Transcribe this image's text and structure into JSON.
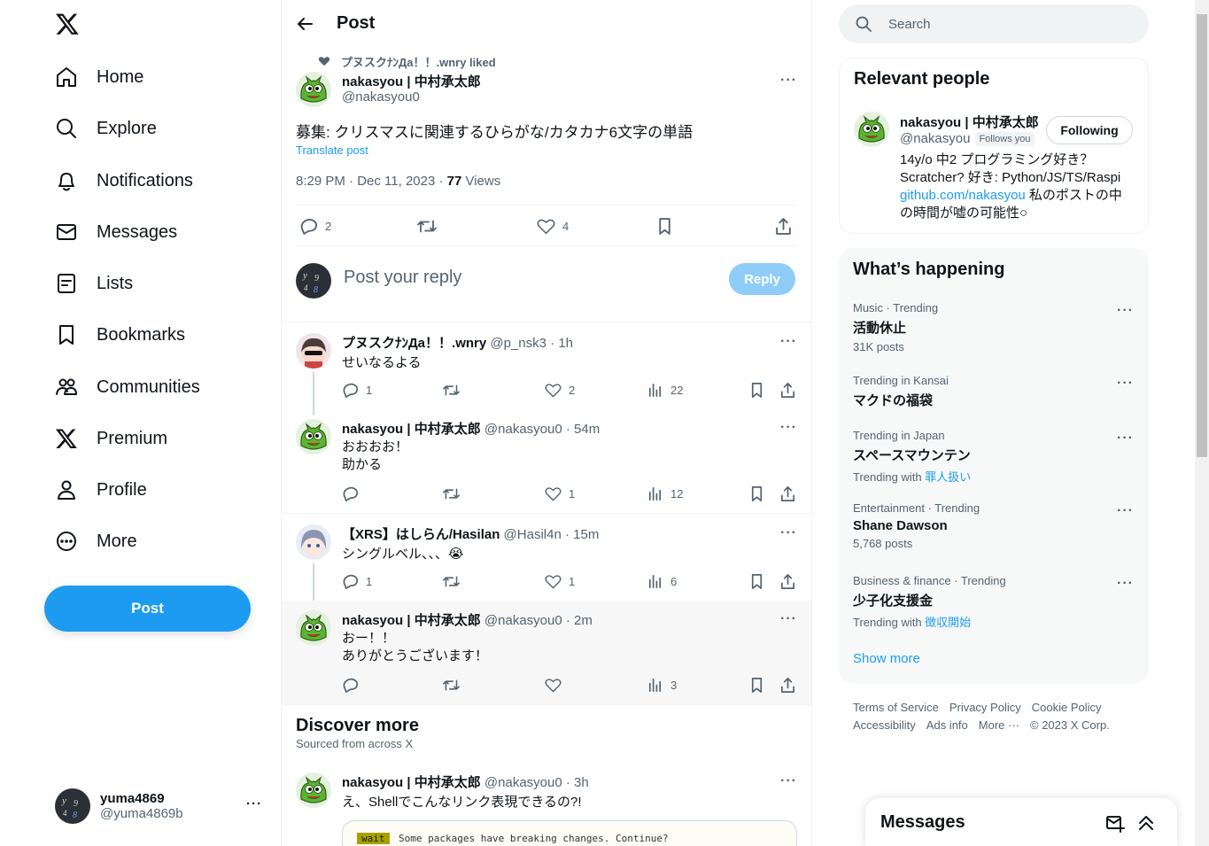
{
  "nav": {
    "items": [
      {
        "label": "Home",
        "icon": "home-icon"
      },
      {
        "label": "Explore",
        "icon": "search-icon"
      },
      {
        "label": "Notifications",
        "icon": "bell-icon"
      },
      {
        "label": "Messages",
        "icon": "envelope-icon"
      },
      {
        "label": "Lists",
        "icon": "list-icon"
      },
      {
        "label": "Bookmarks",
        "icon": "bookmark-icon"
      },
      {
        "label": "Communities",
        "icon": "communities-icon"
      },
      {
        "label": "Premium",
        "icon": "x-logo-icon"
      },
      {
        "label": "Profile",
        "icon": "person-icon"
      },
      {
        "label": "More",
        "icon": "more-circle-icon"
      }
    ],
    "post_button": "Post",
    "account": {
      "name": "yuma4869",
      "handle": "@yuma4869b"
    }
  },
  "header": {
    "title": "Post"
  },
  "main_post": {
    "social_context": "プヌスクﾅﾝДа！！.wnry liked",
    "author_name": "nakasyou | 中村承太郎",
    "author_handle": "@nakasyou0",
    "text": "募集: クリスマスに関連するひらがな/カタカナ6文字の単語",
    "translate": "Translate post",
    "timestamp": "8:29 PM · Dec 11, 2023 · ",
    "views_count": "77",
    "views_label": " Views",
    "replies": "2",
    "likes": "4"
  },
  "reply_box": {
    "placeholder": "Post your reply",
    "button": "Reply"
  },
  "replies": [
    {
      "name": "プヌスクﾅﾝДа！！.wnry",
      "meta": "@p_nsk3 · 1h",
      "lines": [
        "せいなるよる"
      ],
      "replies": "1",
      "retweets": "",
      "likes": "2",
      "views": "22"
    },
    {
      "name": "nakasyou | 中村承太郎",
      "meta": "@nakasyou0 · 54m",
      "lines": [
        "おおおお！",
        "助かる"
      ],
      "replies": "",
      "retweets": "",
      "likes": "1",
      "views": "12"
    },
    {
      "name": "【XRS】はしらん/Hasilan",
      "meta": "@Hasil4n · 15m",
      "lines": [
        "シングルベル、、、😭"
      ],
      "replies": "1",
      "retweets": "",
      "likes": "1",
      "views": "6"
    },
    {
      "name": "nakasyou | 中村承太郎",
      "meta": "@nakasyou0 · 2m",
      "lines": [
        "おー！！",
        "ありがとうございます！"
      ],
      "replies": "",
      "retweets": "",
      "likes": "",
      "views": "3"
    }
  ],
  "discover": {
    "title": "Discover more",
    "subtitle": "Sourced from across X",
    "post": {
      "name": "nakasyou | 中村承太郎",
      "meta": "@nakasyou0 · 3h",
      "text": "え、Shellでこんなリンク表現できるの?!",
      "code_tag": "wait",
      "code_text": "Some packages have breaking changes. Continue?"
    }
  },
  "search": {
    "placeholder": "Search"
  },
  "relevant": {
    "title": "Relevant people",
    "name": "nakasyou | 中村承太郎",
    "handle": "@nakasyou",
    "follows_you": "Follows you",
    "button": "Following",
    "bio_1": "14y/o 中2 プログラミング好き？",
    "bio_2": "Scratcher? 好き: Python/JS/TS/Raspi",
    "bio_link": "github.com/nakasyou",
    "bio_3": " 私のポストの中",
    "bio_4": "の時間が嘘の可能性○"
  },
  "happening": {
    "title": "What’s happening",
    "trends": [
      {
        "cat": "Music · Trending",
        "title": "活動休止",
        "sub": "31K posts",
        "link": ""
      },
      {
        "cat": "Trending in Kansai",
        "title": "マクドの福袋",
        "sub": "",
        "link": ""
      },
      {
        "cat": "Trending in Japan",
        "title": "スペースマウンテン",
        "sub": "Trending with ",
        "link": "罪人扱い"
      },
      {
        "cat": "Entertainment · Trending",
        "title": "Shane Dawson",
        "sub": "5,768 posts",
        "link": ""
      },
      {
        "cat": "Business & finance · Trending",
        "title": "少子化支援金",
        "sub": "Trending with ",
        "link": "徴収開始"
      }
    ],
    "show_more": "Show more"
  },
  "footer": {
    "links": [
      "Terms of Service",
      "Privacy Policy",
      "Cookie Policy",
      "Accessibility",
      "Ads info",
      "More ···",
      "© 2023 X Corp."
    ]
  },
  "messages_drawer": {
    "title": "Messages"
  },
  "colors": {
    "accent": "#1d9bf0",
    "text": "#0f1419",
    "muted": "#536471"
  }
}
